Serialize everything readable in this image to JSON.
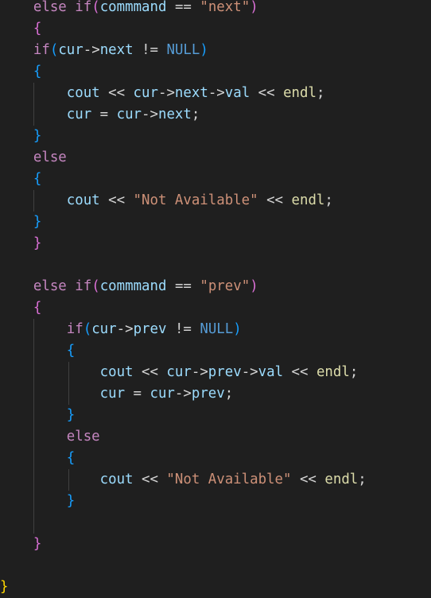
{
  "editor": {
    "theme_colors": {
      "background": "#1f1f1f",
      "keyword_control": "#c586c0",
      "keyword": "#569cd6",
      "variable": "#9cdcfe",
      "string": "#ce9178",
      "function": "#dcdcaa",
      "bracket_level_1": "#da70d6",
      "bracket_level_2": "#179fff",
      "bracket_level_3": "#ffd700"
    },
    "lines": [
      {
        "indent": 2,
        "guides": [],
        "tokens": [
          {
            "t": "else",
            "c": "kw-ctrl"
          },
          {
            "t": " ",
            "c": "op"
          },
          {
            "t": "if",
            "c": "kw-ctrl"
          },
          {
            "t": "(",
            "c": "b1"
          },
          {
            "t": "commmand",
            "c": "var"
          },
          {
            "t": " == ",
            "c": "op"
          },
          {
            "t": "\"next\"",
            "c": "str"
          },
          {
            "t": ")",
            "c": "b1"
          }
        ]
      },
      {
        "indent": 2,
        "guides": [],
        "tokens": [
          {
            "t": "{",
            "c": "b1"
          }
        ]
      },
      {
        "indent": 2,
        "guides": [],
        "tokens": [
          {
            "t": "if",
            "c": "kw-ctrl"
          },
          {
            "t": "(",
            "c": "b2"
          },
          {
            "t": "cur",
            "c": "var"
          },
          {
            "t": "->",
            "c": "op"
          },
          {
            "t": "next",
            "c": "var"
          },
          {
            "t": " != ",
            "c": "op"
          },
          {
            "t": "NULL",
            "c": "kw"
          },
          {
            "t": ")",
            "c": "b2"
          }
        ]
      },
      {
        "indent": 2,
        "guides": [],
        "tokens": [
          {
            "t": "{",
            "c": "b2"
          }
        ]
      },
      {
        "indent": 4,
        "guides": [
          42
        ],
        "tokens": [
          {
            "t": "cout",
            "c": "var"
          },
          {
            "t": " << ",
            "c": "op"
          },
          {
            "t": "cur",
            "c": "var"
          },
          {
            "t": "->",
            "c": "op"
          },
          {
            "t": "next",
            "c": "var"
          },
          {
            "t": "->",
            "c": "op"
          },
          {
            "t": "val",
            "c": "var"
          },
          {
            "t": " << ",
            "c": "op"
          },
          {
            "t": "endl",
            "c": "fn"
          },
          {
            "t": ";",
            "c": "op"
          }
        ]
      },
      {
        "indent": 4,
        "guides": [
          42
        ],
        "tokens": [
          {
            "t": "cur",
            "c": "var"
          },
          {
            "t": " = ",
            "c": "op"
          },
          {
            "t": "cur",
            "c": "var"
          },
          {
            "t": "->",
            "c": "op"
          },
          {
            "t": "next",
            "c": "var"
          },
          {
            "t": ";",
            "c": "op"
          }
        ]
      },
      {
        "indent": 2,
        "guides": [],
        "tokens": [
          {
            "t": "}",
            "c": "b2"
          }
        ]
      },
      {
        "indent": 2,
        "guides": [],
        "tokens": [
          {
            "t": "else",
            "c": "kw-ctrl"
          }
        ]
      },
      {
        "indent": 2,
        "guides": [],
        "tokens": [
          {
            "t": "{",
            "c": "b2"
          }
        ]
      },
      {
        "indent": 4,
        "guides": [
          42
        ],
        "tokens": [
          {
            "t": "cout",
            "c": "var"
          },
          {
            "t": " << ",
            "c": "op"
          },
          {
            "t": "\"Not Available\"",
            "c": "str"
          },
          {
            "t": " << ",
            "c": "op"
          },
          {
            "t": "endl",
            "c": "fn"
          },
          {
            "t": ";",
            "c": "op"
          }
        ]
      },
      {
        "indent": 2,
        "guides": [],
        "tokens": [
          {
            "t": "}",
            "c": "b2"
          }
        ]
      },
      {
        "indent": 2,
        "guides": [],
        "tokens": [
          {
            "t": "}",
            "c": "b1"
          }
        ]
      },
      {
        "indent": 0,
        "guides": [],
        "tokens": []
      },
      {
        "indent": 2,
        "guides": [],
        "tokens": [
          {
            "t": "else",
            "c": "kw-ctrl"
          },
          {
            "t": " ",
            "c": "op"
          },
          {
            "t": "if",
            "c": "kw-ctrl"
          },
          {
            "t": "(",
            "c": "b1"
          },
          {
            "t": "commmand",
            "c": "var"
          },
          {
            "t": " == ",
            "c": "op"
          },
          {
            "t": "\"prev\"",
            "c": "str"
          },
          {
            "t": ")",
            "c": "b1"
          }
        ]
      },
      {
        "indent": 2,
        "guides": [],
        "tokens": [
          {
            "t": "{",
            "c": "b1"
          }
        ]
      },
      {
        "indent": 4,
        "guides": [
          42
        ],
        "tokens": [
          {
            "t": "if",
            "c": "kw-ctrl"
          },
          {
            "t": "(",
            "c": "b2"
          },
          {
            "t": "cur",
            "c": "var"
          },
          {
            "t": "->",
            "c": "op"
          },
          {
            "t": "prev",
            "c": "var"
          },
          {
            "t": " != ",
            "c": "op"
          },
          {
            "t": "NULL",
            "c": "kw"
          },
          {
            "t": ")",
            "c": "b2"
          }
        ]
      },
      {
        "indent": 4,
        "guides": [
          42
        ],
        "tokens": [
          {
            "t": "{",
            "c": "b2"
          }
        ]
      },
      {
        "indent": 6,
        "guides": [
          42,
          86
        ],
        "tokens": [
          {
            "t": "cout",
            "c": "var"
          },
          {
            "t": " << ",
            "c": "op"
          },
          {
            "t": "cur",
            "c": "var"
          },
          {
            "t": "->",
            "c": "op"
          },
          {
            "t": "prev",
            "c": "var"
          },
          {
            "t": "->",
            "c": "op"
          },
          {
            "t": "val",
            "c": "var"
          },
          {
            "t": " << ",
            "c": "op"
          },
          {
            "t": "endl",
            "c": "fn"
          },
          {
            "t": ";",
            "c": "op"
          }
        ]
      },
      {
        "indent": 6,
        "guides": [
          42,
          86
        ],
        "tokens": [
          {
            "t": "cur",
            "c": "var"
          },
          {
            "t": " = ",
            "c": "op"
          },
          {
            "t": "cur",
            "c": "var"
          },
          {
            "t": "->",
            "c": "op"
          },
          {
            "t": "prev",
            "c": "var"
          },
          {
            "t": ";",
            "c": "op"
          }
        ]
      },
      {
        "indent": 4,
        "guides": [
          42
        ],
        "tokens": [
          {
            "t": "}",
            "c": "b2"
          }
        ]
      },
      {
        "indent": 4,
        "guides": [
          42
        ],
        "tokens": [
          {
            "t": "else",
            "c": "kw-ctrl"
          }
        ]
      },
      {
        "indent": 4,
        "guides": [
          42
        ],
        "tokens": [
          {
            "t": "{",
            "c": "b2"
          }
        ]
      },
      {
        "indent": 6,
        "guides": [
          42,
          86
        ],
        "tokens": [
          {
            "t": "cout",
            "c": "var"
          },
          {
            "t": " << ",
            "c": "op"
          },
          {
            "t": "\"Not Available\"",
            "c": "str"
          },
          {
            "t": " << ",
            "c": "op"
          },
          {
            "t": "endl",
            "c": "fn"
          },
          {
            "t": ";",
            "c": "op"
          }
        ]
      },
      {
        "indent": 4,
        "guides": [
          42
        ],
        "tokens": [
          {
            "t": "}",
            "c": "b2"
          }
        ]
      },
      {
        "indent": 2,
        "guides": [
          42
        ],
        "tokens": []
      },
      {
        "indent": 2,
        "guides": [],
        "tokens": [
          {
            "t": "}",
            "c": "b1"
          }
        ]
      },
      {
        "indent": 0,
        "guides": [],
        "tokens": []
      },
      {
        "indent": 0,
        "guides": [],
        "tokens": [
          {
            "t": "}",
            "c": "b3"
          }
        ]
      }
    ]
  }
}
